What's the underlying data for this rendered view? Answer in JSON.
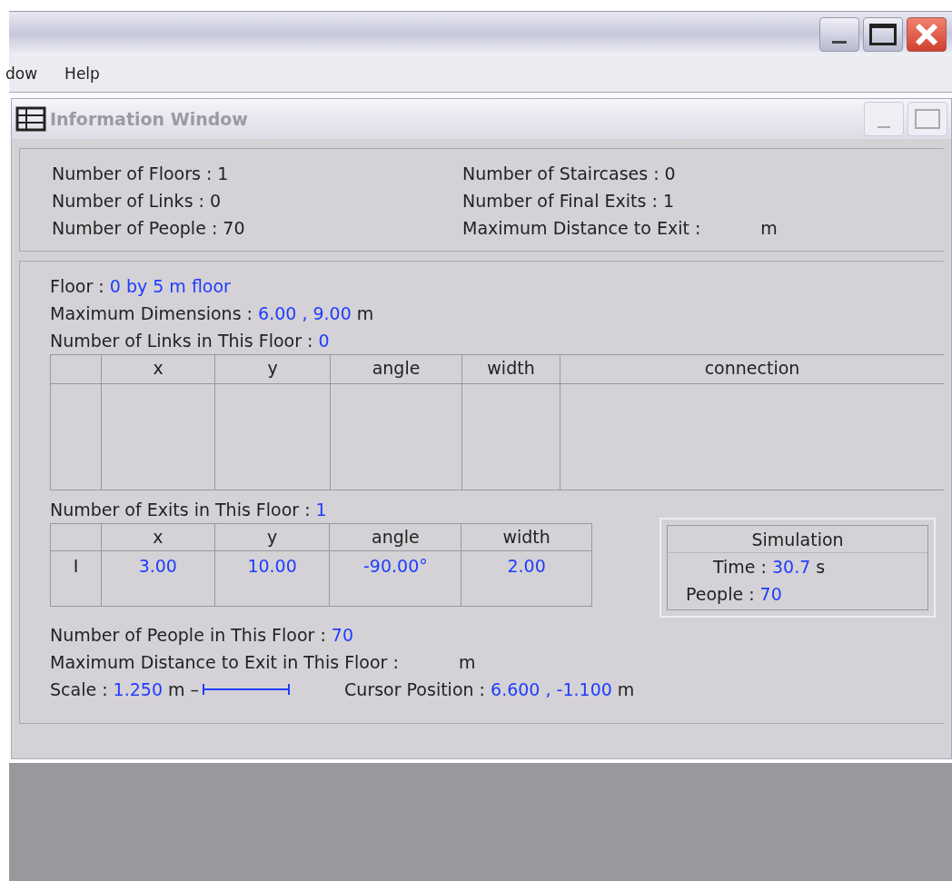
{
  "menu": [
    "dow",
    "Help"
  ],
  "info_window": {
    "title": "Information Window"
  },
  "summary": {
    "left": [
      {
        "label": "Number of Floors :",
        "value": "1"
      },
      {
        "label": "Number of Links :",
        "value": "0"
      },
      {
        "label": "Number of People :",
        "value": "70"
      }
    ],
    "right": [
      {
        "label": "Number of Staircases :",
        "value": "0"
      },
      {
        "label": "Number of Final Exits :",
        "value": "1"
      },
      {
        "label": "Maximum Distance to Exit :",
        "unit": "m"
      }
    ]
  },
  "floor": {
    "lines": [
      {
        "label": "Floor :",
        "value": "0 by 5 m floor"
      },
      {
        "label": "Maximum Dimensions :",
        "value": "6.00 , 9.00",
        "unit": "m"
      },
      {
        "label": "Number of Links in This Floor :",
        "value": "0"
      }
    ],
    "links_table": {
      "columns": [
        "",
        "x",
        "y",
        "angle",
        "width",
        "connection"
      ]
    },
    "exits_label": {
      "label": "Number of Exits in This Floor :",
      "value": "1"
    },
    "exits_table": {
      "columns": [
        "",
        "x",
        "y",
        "angle",
        "width"
      ],
      "rows": [
        [
          "I",
          "3.00",
          "10.00",
          "-90.00°",
          "2.00"
        ]
      ]
    },
    "simulation": {
      "title": "Simulation",
      "items": [
        {
          "label": "Time :",
          "value": "30.7",
          "unit": "s"
        },
        {
          "label": "People :",
          "value": "70"
        }
      ]
    },
    "bottom_lines": [
      {
        "label": "Number of People in This Floor :",
        "value": "70"
      },
      {
        "label": "Maximum Distance to Exit in This Floor :",
        "unit": "m"
      }
    ],
    "scale": {
      "label": "Scale :",
      "value": "1.250",
      "unit": "m –"
    },
    "cursor": {
      "label": "Cursor Position :",
      "value": "6.600 , -1.100",
      "unit": "m"
    }
  }
}
